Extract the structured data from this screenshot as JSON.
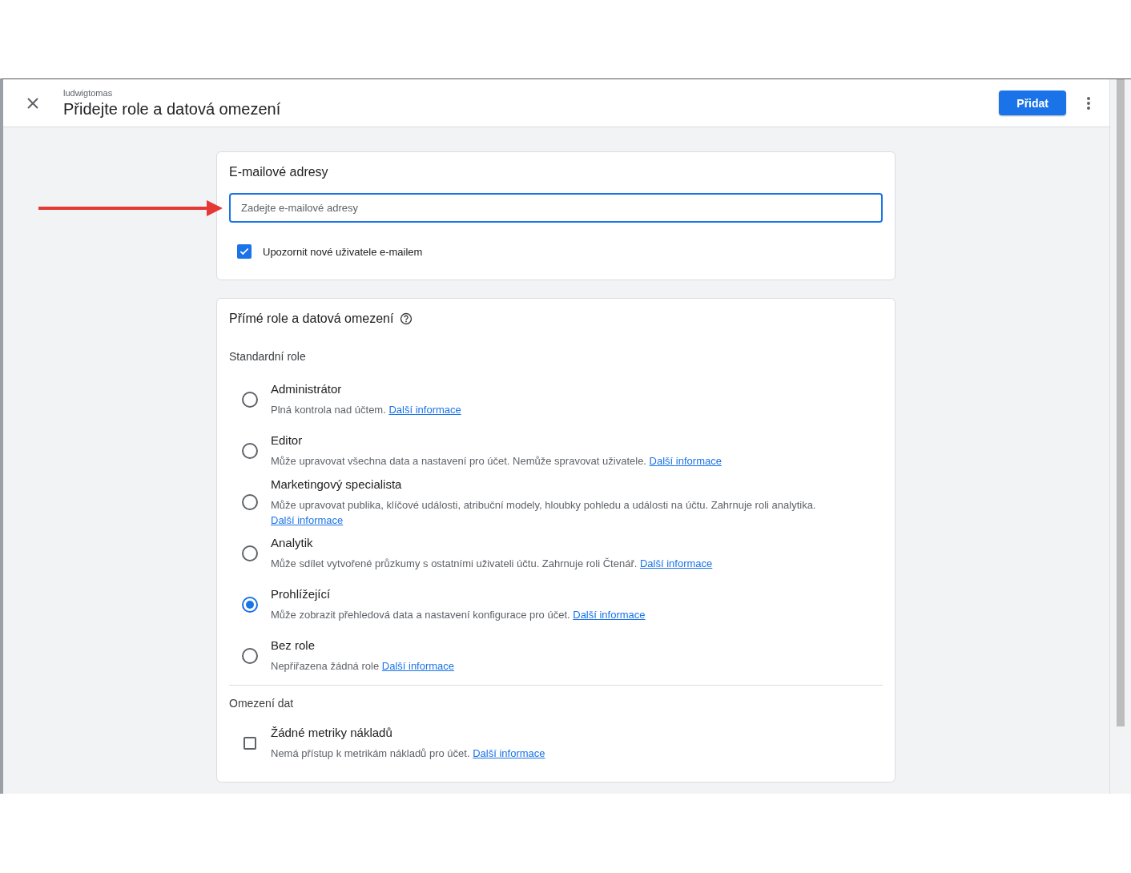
{
  "header": {
    "account": "ludwigtomas",
    "title": "Přidejte role a datová omezení",
    "primary_button": "Přidat"
  },
  "email_card": {
    "title": "E-mailové adresy",
    "field": {
      "placeholder": "Zadejte e-mailové adresy"
    },
    "notify": {
      "label": "Upozornit nové uživatele e-mailem",
      "checked": true
    }
  },
  "roles_card": {
    "title": "Přímé role a datová omezení",
    "standard_heading": "Standardní role",
    "roles": [
      {
        "name": "Administrátor",
        "description": "Plná kontrola nad účtem.",
        "link": "Další informace",
        "selected": false
      },
      {
        "name": "Editor",
        "description": "Může upravovat všechna data a nastavení pro účet. Nemůže spravovat uživatele.",
        "link": "Další informace",
        "selected": false
      },
      {
        "name": "Marketingový specialista",
        "description": "Může upravovat publika, klíčové události, atribuční modely, hloubky pohledu a události na účtu. Zahrnuje roli analytika.",
        "link": "Další informace",
        "selected": false
      },
      {
        "name": "Analytik",
        "description": "Může sdílet vytvořené průzkumy s ostatními uživateli účtu. Zahrnuje roli Čtenář.",
        "link": "Další informace",
        "selected": false
      },
      {
        "name": "Prohlížející",
        "description": "Může zobrazit přehledová data a nastavení konfigurace pro účet.",
        "link": "Další informace",
        "selected": true
      },
      {
        "name": "Bez role",
        "description": "Nepřiřazena žádná role",
        "link": "Další informace",
        "selected": false
      }
    ],
    "restrictions_heading": "Omezení dat",
    "restrictions": [
      {
        "name": "Žádné metriky nákladů",
        "description": "Nemá přístup k metrikám nákladů pro účet.",
        "link": "Další informace",
        "checked": false
      }
    ]
  }
}
